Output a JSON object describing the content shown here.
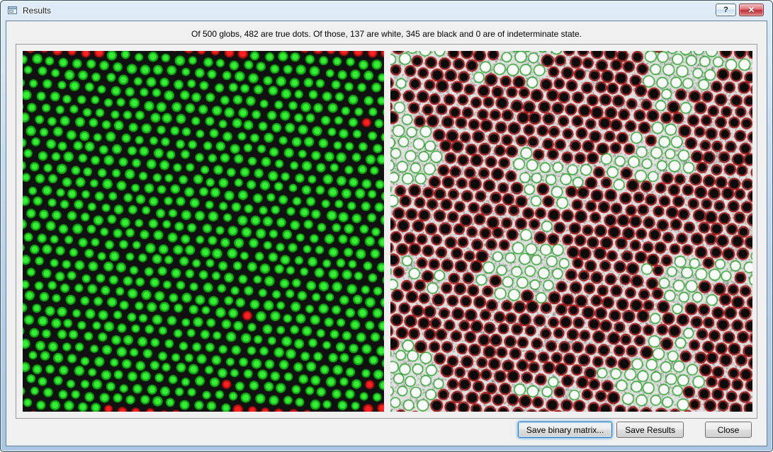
{
  "window": {
    "title": "Results"
  },
  "icons": {
    "help": "?",
    "close": "✕"
  },
  "summary": "Of 500 globs, 482 are true dots. Of those, 137 are white, 345 are black and 0 are of indeterminate state.",
  "stats": {
    "globs": 500,
    "true_dots": 482,
    "white": 137,
    "black": 345,
    "indeterminate": 0
  },
  "buttons": {
    "save_binary": "Save binary matrix...",
    "save_results": "Save Results",
    "close": "Close"
  },
  "colors": {
    "dot_green": "#35ef35",
    "dot_green_dark": "#13ad13",
    "reject_red": "#ff2020",
    "reject_dark": "#b51010",
    "outline_red": "#a81010",
    "outline_green": "#17a017",
    "focus_blue": "#3c7fb1"
  }
}
